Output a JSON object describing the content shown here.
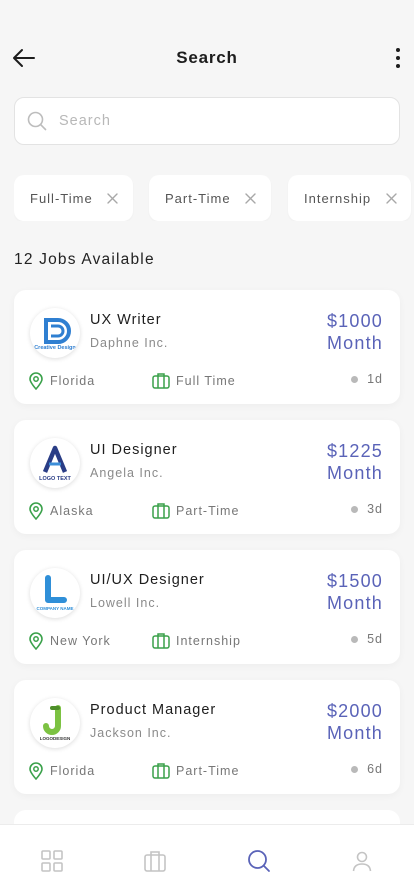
{
  "header": {
    "title": "Search"
  },
  "search": {
    "placeholder": "Search",
    "value": ""
  },
  "filters": [
    {
      "label": "Full-Time"
    },
    {
      "label": "Part-Time"
    },
    {
      "label": "Internship"
    }
  ],
  "results": {
    "count_label": "12 Jobs Available"
  },
  "jobs": [
    {
      "title": "UX Writer",
      "company": "Daphne Inc.",
      "salary": "$1000",
      "period": "Month",
      "location": "Florida",
      "type": "Full Time",
      "posted": "1d",
      "logo": "creative-design-logo",
      "logo_text": "Creative Design"
    },
    {
      "title": "UI Designer",
      "company": "Angela Inc.",
      "salary": "$1225",
      "period": "Month",
      "location": "Alaska",
      "type": "Part-Time",
      "posted": "3d",
      "logo": "logo-text-logo",
      "logo_text": "LOGO TEXT"
    },
    {
      "title": "UI/UX Designer",
      "company": "Lowell Inc.",
      "salary": "$1500",
      "period": "Month",
      "location": "New York",
      "type": "Internship",
      "posted": "5d",
      "logo": "company-name-logo",
      "logo_text": "COMPANY NAME"
    },
    {
      "title": "Product Manager",
      "company": "Jackson Inc.",
      "salary": "$2000",
      "period": "Month",
      "location": "Florida",
      "type": "Part-Time",
      "posted": "6d",
      "logo": "logodesign-logo",
      "logo_text": "LOGODESIGN"
    }
  ],
  "nav": [
    {
      "icon": "grid-icon",
      "active": false
    },
    {
      "icon": "briefcase-icon",
      "active": false
    },
    {
      "icon": "search-icon",
      "active": true
    },
    {
      "icon": "user-icon",
      "active": false
    }
  ],
  "colors": {
    "accent": "#5a63b8",
    "location_green": "#3aa14a",
    "background": "#f6f6f6",
    "nav_inactive": "#c4c4c4",
    "nav_active": "#5a63b8"
  }
}
